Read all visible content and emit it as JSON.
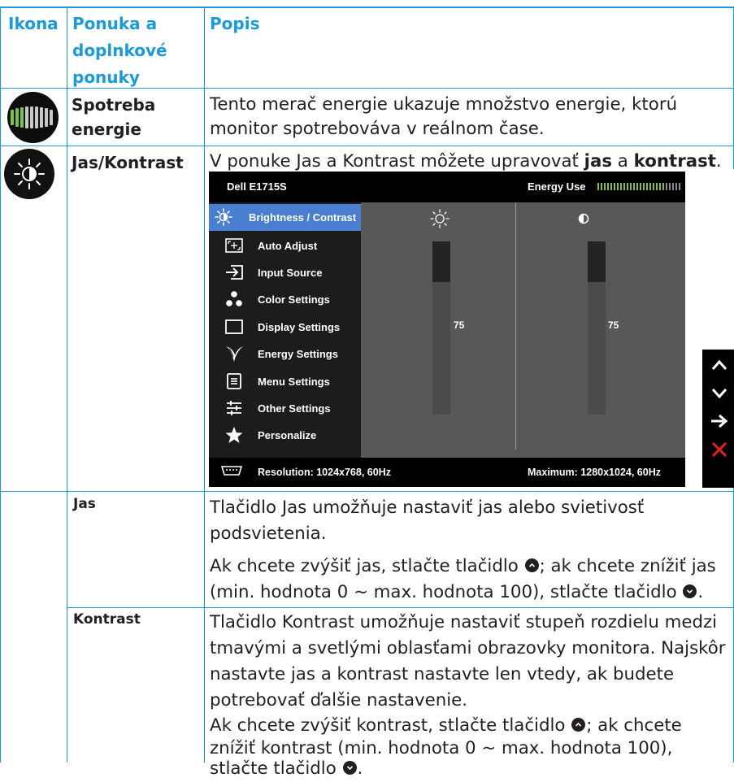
{
  "header": {
    "icon": "Ikona",
    "menu_line1": "Ponuka a",
    "menu_line2": "doplnkové",
    "menu_line3": "ponuky",
    "desc": "Popis"
  },
  "energy_row": {
    "icon": "energy-meter-icon",
    "name_line1": "Spotreba",
    "name_line2": "energie",
    "desc_line1": "Tento merač energie ukazuje množstvo energie, ktorú",
    "desc_line2": "monitor spotrebováva v reálnom čase."
  },
  "brightness_row": {
    "icon": "brightness-contrast-icon",
    "name": "Jas/Kontrast",
    "desc_pre": "V ponuke Jas a Kontrast môžete upravovať ",
    "desc_b1": "jas",
    "desc_mid": " a ",
    "desc_b2": "kontrast",
    "desc_post": "."
  },
  "osd": {
    "title": "Dell E1715S",
    "energy_label": "Energy Use",
    "menu": [
      {
        "label": "Brightness / Contrast",
        "icon": "brightness-icon",
        "active": true
      },
      {
        "label": "Auto Adjust",
        "icon": "auto-adjust-icon"
      },
      {
        "label": "Input Source",
        "icon": "input-source-icon"
      },
      {
        "label": "Color Settings",
        "icon": "color-settings-icon"
      },
      {
        "label": "Display Settings",
        "icon": "display-settings-icon"
      },
      {
        "label": "Energy Settings",
        "icon": "energy-settings-icon"
      },
      {
        "label": "Menu Settings",
        "icon": "menu-settings-icon"
      },
      {
        "label": "Other Settings",
        "icon": "other-settings-icon"
      },
      {
        "label": "Personalize",
        "icon": "personalize-icon"
      }
    ],
    "brightness_value": "75",
    "contrast_value": "75",
    "resolution": "Resolution: 1024x768, 60Hz",
    "maximum": "Maximum: 1280x1024, 60Hz",
    "nav_icons": [
      "up-arrow-icon",
      "down-arrow-icon",
      "right-arrow-icon",
      "close-icon"
    ]
  },
  "jas_row": {
    "name": "Jas",
    "p1_line1": "Tlačidlo Jas umožňuje nastaviť jas alebo svietivosť",
    "p1_line2": "podsvietenia.",
    "p2_line1_pre": "Ak chcete zvýšiť jas, stlačte tlačidlo ",
    "p2_line1_post": "; ak chcete znížiť jas",
    "p2_line2_pre": "(min. hodnota 0 ~ max. hodnota 100), stlačte tlačidlo ",
    "p2_line2_post": "."
  },
  "kontrast_row": {
    "name": "Kontrast",
    "p1_line1": "Tlačidlo Kontrast umožňuje nastaviť stupeň rozdielu medzi",
    "p1_line2": "tmavými a svetlými oblasťami obrazovky monitora. Najskôr",
    "p1_line3": "nastavte jas a kontrast nastavte len vtedy, ak budete",
    "p1_line4": "potrebovať ďalšie nastavenie.",
    "p2_line1_pre": "Ak chcete zvýšiť kontrast, stlačte tlačidlo ",
    "p2_line1_post": "; ak chcete",
    "p2_line2": "znížiť kontrast (min. hodnota 0 ~ max. hodnota 100),",
    "p2_line3_pre": "stlačte tlačidlo ",
    "p2_line3_post": "."
  },
  "colors": {
    "accent": "#1a9bd7",
    "osd_highlight": "#4a7ed1",
    "meter_green": "#7ec242",
    "close_red": "#e2231a"
  }
}
